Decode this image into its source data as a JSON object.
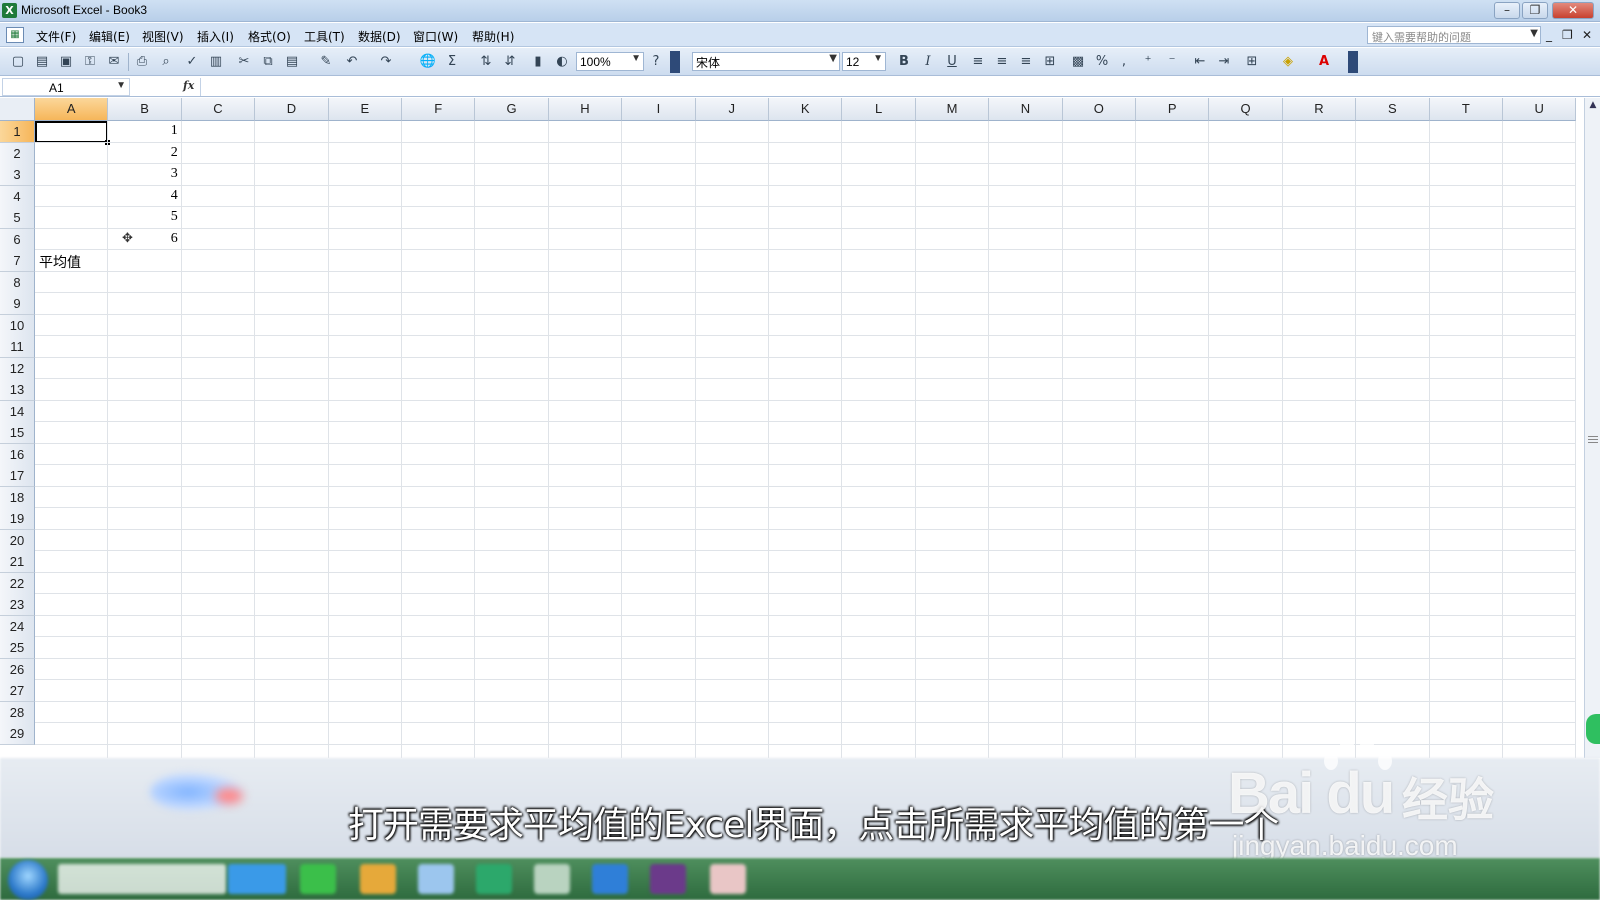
{
  "window": {
    "title": "Microsoft Excel - Book3",
    "app_icon": "excel-icon"
  },
  "menu": {
    "items": [
      "文件(F)",
      "编辑(E)",
      "视图(V)",
      "插入(I)",
      "格式(O)",
      "工具(T)",
      "数据(D)",
      "窗口(W)",
      "帮助(H)"
    ],
    "help_placeholder": "键入需要帮助的问题"
  },
  "toolbar": {
    "zoom": "100%",
    "font_name": "宋体",
    "font_size": "12",
    "bold": "B",
    "italic": "I",
    "underline": "U",
    "sum": "Σ",
    "percent": "%"
  },
  "formula_bar": {
    "name_box": "A1",
    "fx_label": "fx",
    "formula": ""
  },
  "grid": {
    "columns": [
      "A",
      "B",
      "C",
      "D",
      "E",
      "F",
      "G",
      "H",
      "I",
      "J",
      "K",
      "L",
      "M",
      "N",
      "O",
      "P",
      "Q",
      "R",
      "S",
      "T",
      "U"
    ],
    "rows": [
      "1",
      "2",
      "3",
      "4",
      "5",
      "6",
      "7",
      "8",
      "9",
      "10",
      "11",
      "12",
      "13",
      "14",
      "15",
      "16",
      "17",
      "18",
      "19",
      "20",
      "21",
      "22",
      "23",
      "24",
      "25",
      "26",
      "27",
      "28",
      "29"
    ],
    "active_cell": "A1",
    "cells": {
      "B1": "1",
      "B2": "2",
      "B3": "3",
      "B4": "4",
      "B5": "5",
      "B6": "6",
      "A7": "平均值"
    }
  },
  "overlay": {
    "subtitle": "打开需要求平均值的Excel界面，点击所需求平均值的第一个",
    "watermark_brand": "Bai du",
    "watermark_cn": "经验",
    "watermark_url": "jingyan.baidu.com"
  },
  "colors": {
    "active_header": "#f6b65a",
    "title_bar": "#b8cfe9",
    "taskbar": "#2e6b3e"
  }
}
